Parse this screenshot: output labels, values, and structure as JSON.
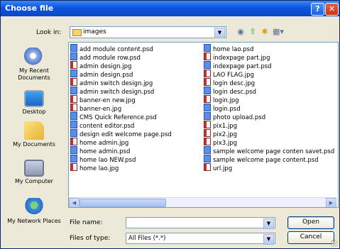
{
  "title": "Choose file",
  "title_buttons": {
    "help": "?",
    "close": "✕"
  },
  "look_in": {
    "label": "Look in:",
    "value": "images"
  },
  "toolbar": [
    "back-icon",
    "up-folder-icon",
    "new-folder-icon",
    "view-menu-icon"
  ],
  "places": [
    {
      "label": "My Recent Documents",
      "icon": "recent-documents-icon"
    },
    {
      "label": "Desktop",
      "icon": "desktop-icon"
    },
    {
      "label": "My Documents",
      "icon": "my-documents-icon"
    },
    {
      "label": "My Computer",
      "icon": "my-computer-icon"
    },
    {
      "label": "My Network Places",
      "icon": "network-places-icon"
    }
  ],
  "files_left": [
    {
      "name": "add module content.psd",
      "type": "psd"
    },
    {
      "name": "add module row.psd",
      "type": "psd"
    },
    {
      "name": "admin design.jpg",
      "type": "jpg"
    },
    {
      "name": "admin design.psd",
      "type": "psd"
    },
    {
      "name": "admin switch design.jpg",
      "type": "jpg"
    },
    {
      "name": "admin switch design.psd",
      "type": "psd"
    },
    {
      "name": "banner-en new.jpg",
      "type": "jpg"
    },
    {
      "name": "banner-en.jpg",
      "type": "jpg"
    },
    {
      "name": "CMS Quick Reference.psd",
      "type": "psd"
    },
    {
      "name": "content editor.psd",
      "type": "psd"
    },
    {
      "name": "design edit welcome page.psd",
      "type": "psd"
    },
    {
      "name": "home admin.jpg",
      "type": "jpg"
    },
    {
      "name": "home admin.psd",
      "type": "psd"
    },
    {
      "name": "home lao NEW.psd",
      "type": "psd"
    },
    {
      "name": "home lao.jpg",
      "type": "jpg"
    }
  ],
  "files_right": [
    {
      "name": "home lao.psd",
      "type": "psd"
    },
    {
      "name": "indexpage part.jpg",
      "type": "jpg"
    },
    {
      "name": "indexpage part.psd",
      "type": "psd"
    },
    {
      "name": "LAO FLAG.jpg",
      "type": "jpg"
    },
    {
      "name": "login desc.jpg",
      "type": "jpg"
    },
    {
      "name": "login desc.psd",
      "type": "psd"
    },
    {
      "name": "login.jpg",
      "type": "jpg"
    },
    {
      "name": "login.psd",
      "type": "psd"
    },
    {
      "name": "photo upload.psd",
      "type": "psd"
    },
    {
      "name": "pix1.jpg",
      "type": "jpg"
    },
    {
      "name": "pix2.jpg",
      "type": "jpg"
    },
    {
      "name": "pix3.jpg",
      "type": "jpg"
    },
    {
      "name": "sample welcome page conten savet.psd",
      "type": "psd"
    },
    {
      "name": "sample welcome page content.psd",
      "type": "psd"
    },
    {
      "name": "url.jpg",
      "type": "jpg"
    }
  ],
  "file_name": {
    "label": "File name:",
    "value": ""
  },
  "file_type": {
    "label": "Files of type:",
    "value": "All Files (*.*)"
  },
  "buttons": {
    "open": "Open",
    "cancel": "Cancel"
  }
}
